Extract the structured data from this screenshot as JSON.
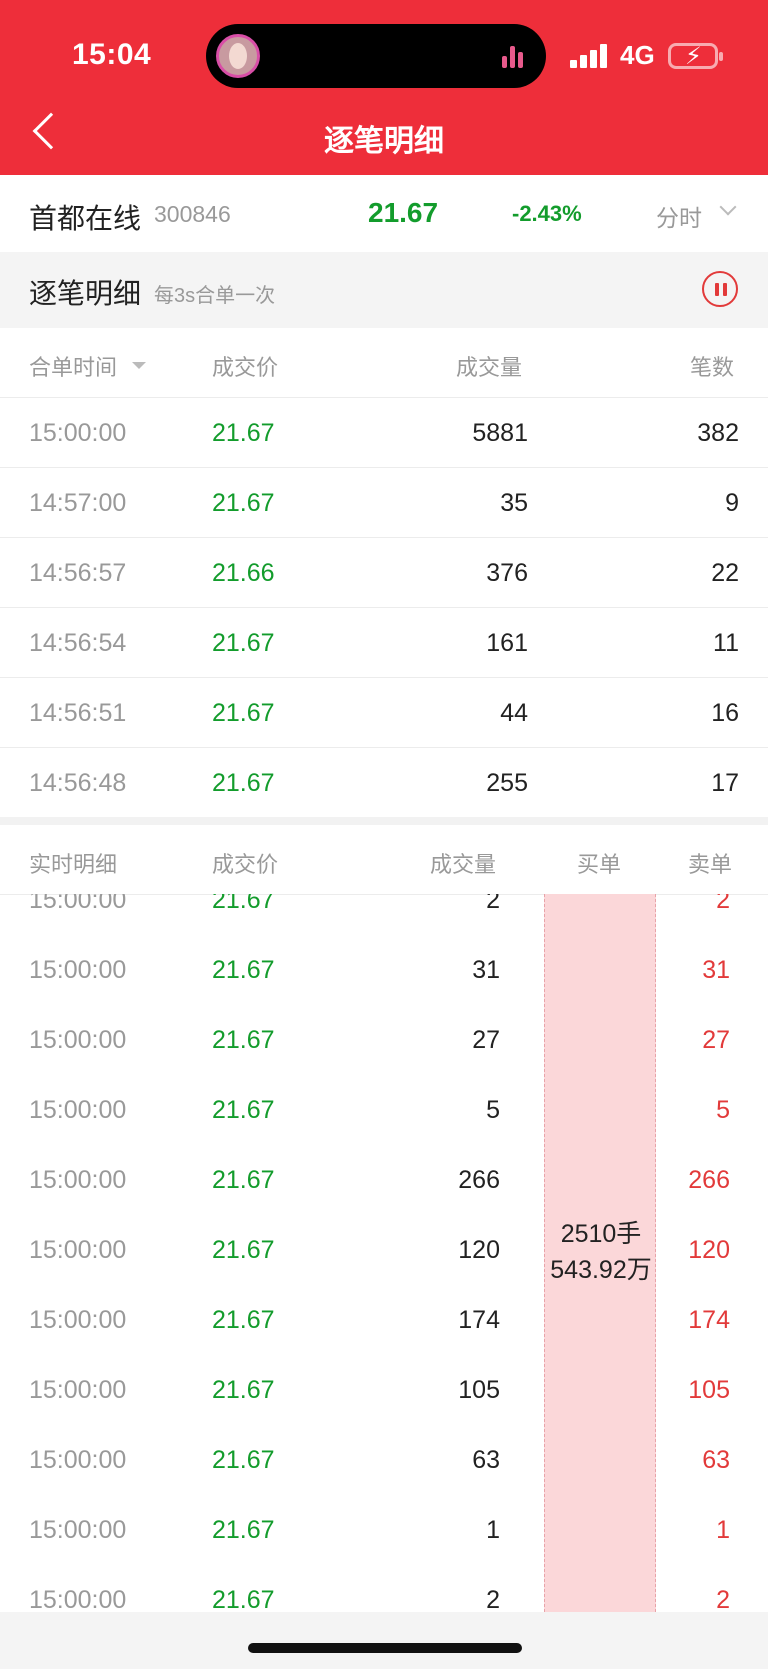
{
  "status": {
    "time": "15:04",
    "network": "4G"
  },
  "header": {
    "title": "逐笔明细"
  },
  "stock": {
    "name": "首都在线",
    "code": "300846",
    "price": "21.67",
    "change": "-2.43%",
    "period": "分时"
  },
  "section": {
    "title": "逐笔明细",
    "subtitle": "每3s合单一次"
  },
  "merged_table": {
    "headers": {
      "time": "合单时间",
      "price": "成交价",
      "volume": "成交量",
      "count": "笔数"
    },
    "rows": [
      {
        "time": "15:00:00",
        "price": "21.67",
        "volume": "5881",
        "count": "382"
      },
      {
        "time": "14:57:00",
        "price": "21.67",
        "volume": "35",
        "count": "9"
      },
      {
        "time": "14:56:57",
        "price": "21.66",
        "volume": "376",
        "count": "22"
      },
      {
        "time": "14:56:54",
        "price": "21.67",
        "volume": "161",
        "count": "11"
      },
      {
        "time": "14:56:51",
        "price": "21.67",
        "volume": "44",
        "count": "16"
      },
      {
        "time": "14:56:48",
        "price": "21.67",
        "volume": "255",
        "count": "17"
      }
    ]
  },
  "realtime_table": {
    "headers": {
      "time": "实时明细",
      "price": "成交价",
      "volume": "成交量",
      "buy": "买单",
      "sell": "卖单"
    },
    "buy_summary": {
      "lots": "2510手",
      "amount": "543.92万"
    },
    "rows": [
      {
        "time": "15:00:00",
        "price": "21.67",
        "volume": "2",
        "sell": "2"
      },
      {
        "time": "15:00:00",
        "price": "21.67",
        "volume": "31",
        "sell": "31"
      },
      {
        "time": "15:00:00",
        "price": "21.67",
        "volume": "27",
        "sell": "27"
      },
      {
        "time": "15:00:00",
        "price": "21.67",
        "volume": "5",
        "sell": "5"
      },
      {
        "time": "15:00:00",
        "price": "21.67",
        "volume": "266",
        "sell": "266"
      },
      {
        "time": "15:00:00",
        "price": "21.67",
        "volume": "120",
        "sell": "120"
      },
      {
        "time": "15:00:00",
        "price": "21.67",
        "volume": "174",
        "sell": "174"
      },
      {
        "time": "15:00:00",
        "price": "21.67",
        "volume": "105",
        "sell": "105"
      },
      {
        "time": "15:00:00",
        "price": "21.67",
        "volume": "63",
        "sell": "63"
      },
      {
        "time": "15:00:00",
        "price": "21.67",
        "volume": "1",
        "sell": "1"
      },
      {
        "time": "15:00:00",
        "price": "21.67",
        "volume": "2",
        "sell": "2"
      }
    ]
  },
  "colors": {
    "header_red": "#ee2e3a",
    "down_green": "#139c2c",
    "sell_red": "#e23a3a",
    "buy_highlight": "#fbd7d9"
  }
}
